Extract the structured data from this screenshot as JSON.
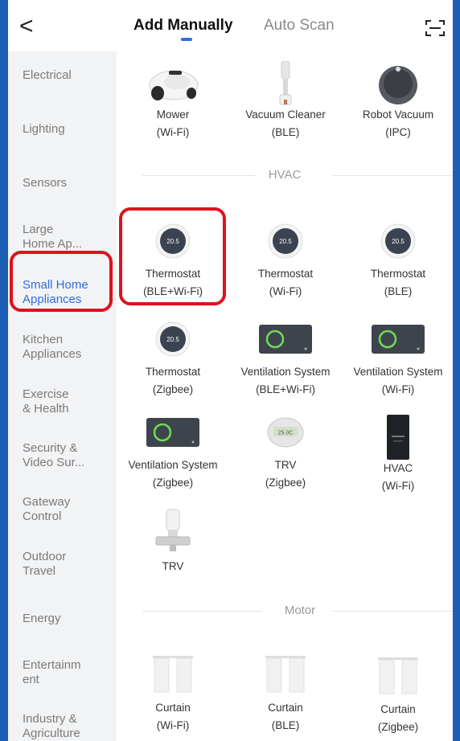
{
  "header": {
    "back_glyph": "<",
    "tab_add": "Add Manually",
    "tab_auto": "Auto Scan",
    "scan_icon": "scan-icon"
  },
  "sidebar": {
    "items": [
      {
        "label": "Electrical"
      },
      {
        "label": "Lighting"
      },
      {
        "label": "Sensors"
      },
      {
        "label": "Large\nHome Ap..."
      },
      {
        "label": "Small Home\nAppliances",
        "active": true
      },
      {
        "label": "Kitchen\nAppliances"
      },
      {
        "label": "Exercise\n& Health"
      },
      {
        "label": "Security &\nVideo Sur..."
      },
      {
        "label": "Gateway\nControl"
      },
      {
        "label": "Outdoor\nTravel"
      },
      {
        "label": "Energy"
      },
      {
        "label": "Entertainm\nent"
      },
      {
        "label": "Industry &\nAgriculture"
      }
    ]
  },
  "top_devices": [
    {
      "name": "Mower",
      "sub": "(Wi-Fi)"
    },
    {
      "name": "Vacuum Cleaner",
      "sub": "(BLE)"
    },
    {
      "name": "Robot Vacuum",
      "sub": "(IPC)"
    }
  ],
  "hvac": {
    "title": "HVAC",
    "thermostat_display": "20.5",
    "trv_display": "25.0C",
    "devices": [
      {
        "name": "Thermostat",
        "sub": "(BLE+Wi-Fi)"
      },
      {
        "name": "Thermostat",
        "sub": "(Wi-Fi)"
      },
      {
        "name": "Thermostat",
        "sub": "(BLE)"
      },
      {
        "name": "Thermostat",
        "sub": "(Zigbee)"
      },
      {
        "name": "Ventilation System",
        "sub": "(BLE+Wi-Fi)"
      },
      {
        "name": "Ventilation System",
        "sub": "(Wi-Fi)"
      },
      {
        "name": "Ventilation System",
        "sub": "(Zigbee)"
      },
      {
        "name": "TRV",
        "sub": "(Zigbee)"
      },
      {
        "name": "HVAC",
        "sub": "(Wi-Fi)"
      },
      {
        "name": "TRV",
        "sub": ""
      }
    ]
  },
  "motor": {
    "title": "Motor",
    "devices": [
      {
        "name": "Curtain",
        "sub": "(Wi-Fi)"
      },
      {
        "name": "Curtain",
        "sub": "(BLE)"
      },
      {
        "name": "Curtain",
        "sub": "(Zigbee)"
      }
    ]
  },
  "colors": {
    "accent": "#2f6fe0",
    "highlight": "#e0101e",
    "background": "#1a5fb4"
  }
}
